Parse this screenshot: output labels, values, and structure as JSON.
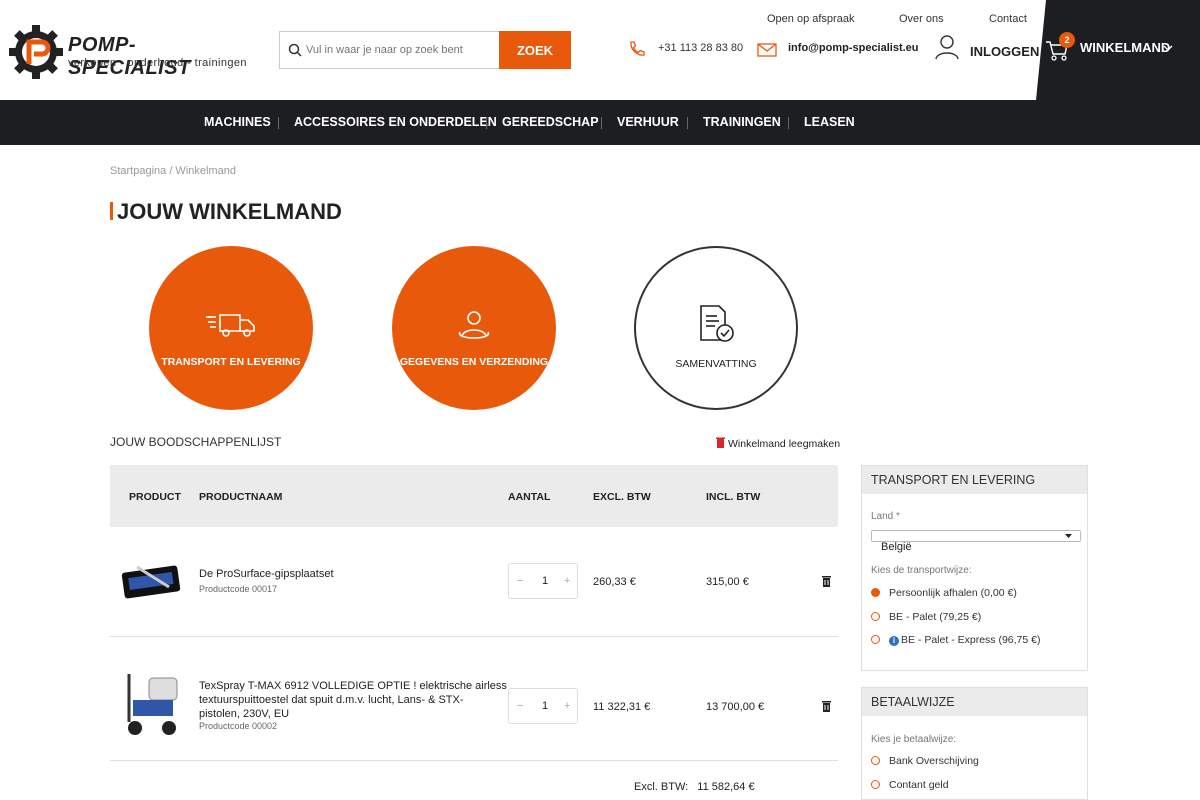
{
  "brand": {
    "name_a": "POMP-SPECIALIST",
    "tagline": "verkopen - onderhoud - trainingen",
    "accent": "#e8590c",
    "dark": "#1c1e22"
  },
  "search": {
    "placeholder": "Vul in waar je naar op zoek bent",
    "button": "ZOEK"
  },
  "toplinks": [
    "Open op afspraak",
    "Over ons",
    "Contact"
  ],
  "contact": {
    "phone": "+31 113 28 83 80",
    "email": "info@pomp-specialist.eu"
  },
  "account": {
    "login": "INLOGGEN"
  },
  "cart": {
    "label": "WINKELMAND",
    "count": "2"
  },
  "nav": [
    "MACHINES",
    "ACCESSOIRES EN ONDERDELEN",
    "GEREEDSCHAP",
    "VERHUUR",
    "TRAININGEN",
    "LEASEN"
  ],
  "breadcrumb": "Startpagina / Winkelmand",
  "page_title": "JOUW WINKELMAND",
  "steps": [
    "TRANSPORT EN LEVERING",
    "GEGEVENS EN VERZENDING",
    "SAMENVATTING"
  ],
  "list": {
    "title": "JOUW BOODSCHAPPENLIJST",
    "empty": "Winkelmand leegmaken"
  },
  "table": {
    "headers": [
      "PRODUCT",
      "PRODUCTNAAM",
      "AANTAL",
      "EXCL. BTW",
      "INCL. BTW"
    ],
    "rows": [
      {
        "name": "De ProSurface-gipsplaatset",
        "name2": "",
        "name3": "",
        "code": "Productcode 00017",
        "qty": "1",
        "excl": "260,33 €",
        "incl": "315,00 €"
      },
      {
        "name": "TexSpray T-MAX 6912 VOLLEDIGE OPTIE ! elektrische airless",
        "name2": "textuurspuittoestel dat spuit d.m.v. lucht, Lans- & STX-",
        "name3": "pistolen, 230V, EU",
        "code": "Productcode 00002",
        "qty": "1",
        "excl": "11 322,31 €",
        "incl": "13 700,00 €"
      }
    ],
    "total_label": "Excl. BTW:",
    "total_value": "11 582,64 €"
  },
  "transport": {
    "title": "TRANSPORT EN LEVERING",
    "country_label": "Land *",
    "country": "België",
    "method_label": "Kies de transportwijze:",
    "options": [
      "Persoonlijk afhalen (0,00 €)",
      "BE - Palet (79,25 €)",
      "BE - Palet - Express (96,75 €)"
    ]
  },
  "payment": {
    "title": "BETAALWIJZE",
    "label": "Kies je betaalwijze:",
    "options": [
      "Bank Overschijving",
      "Contant geld"
    ]
  }
}
